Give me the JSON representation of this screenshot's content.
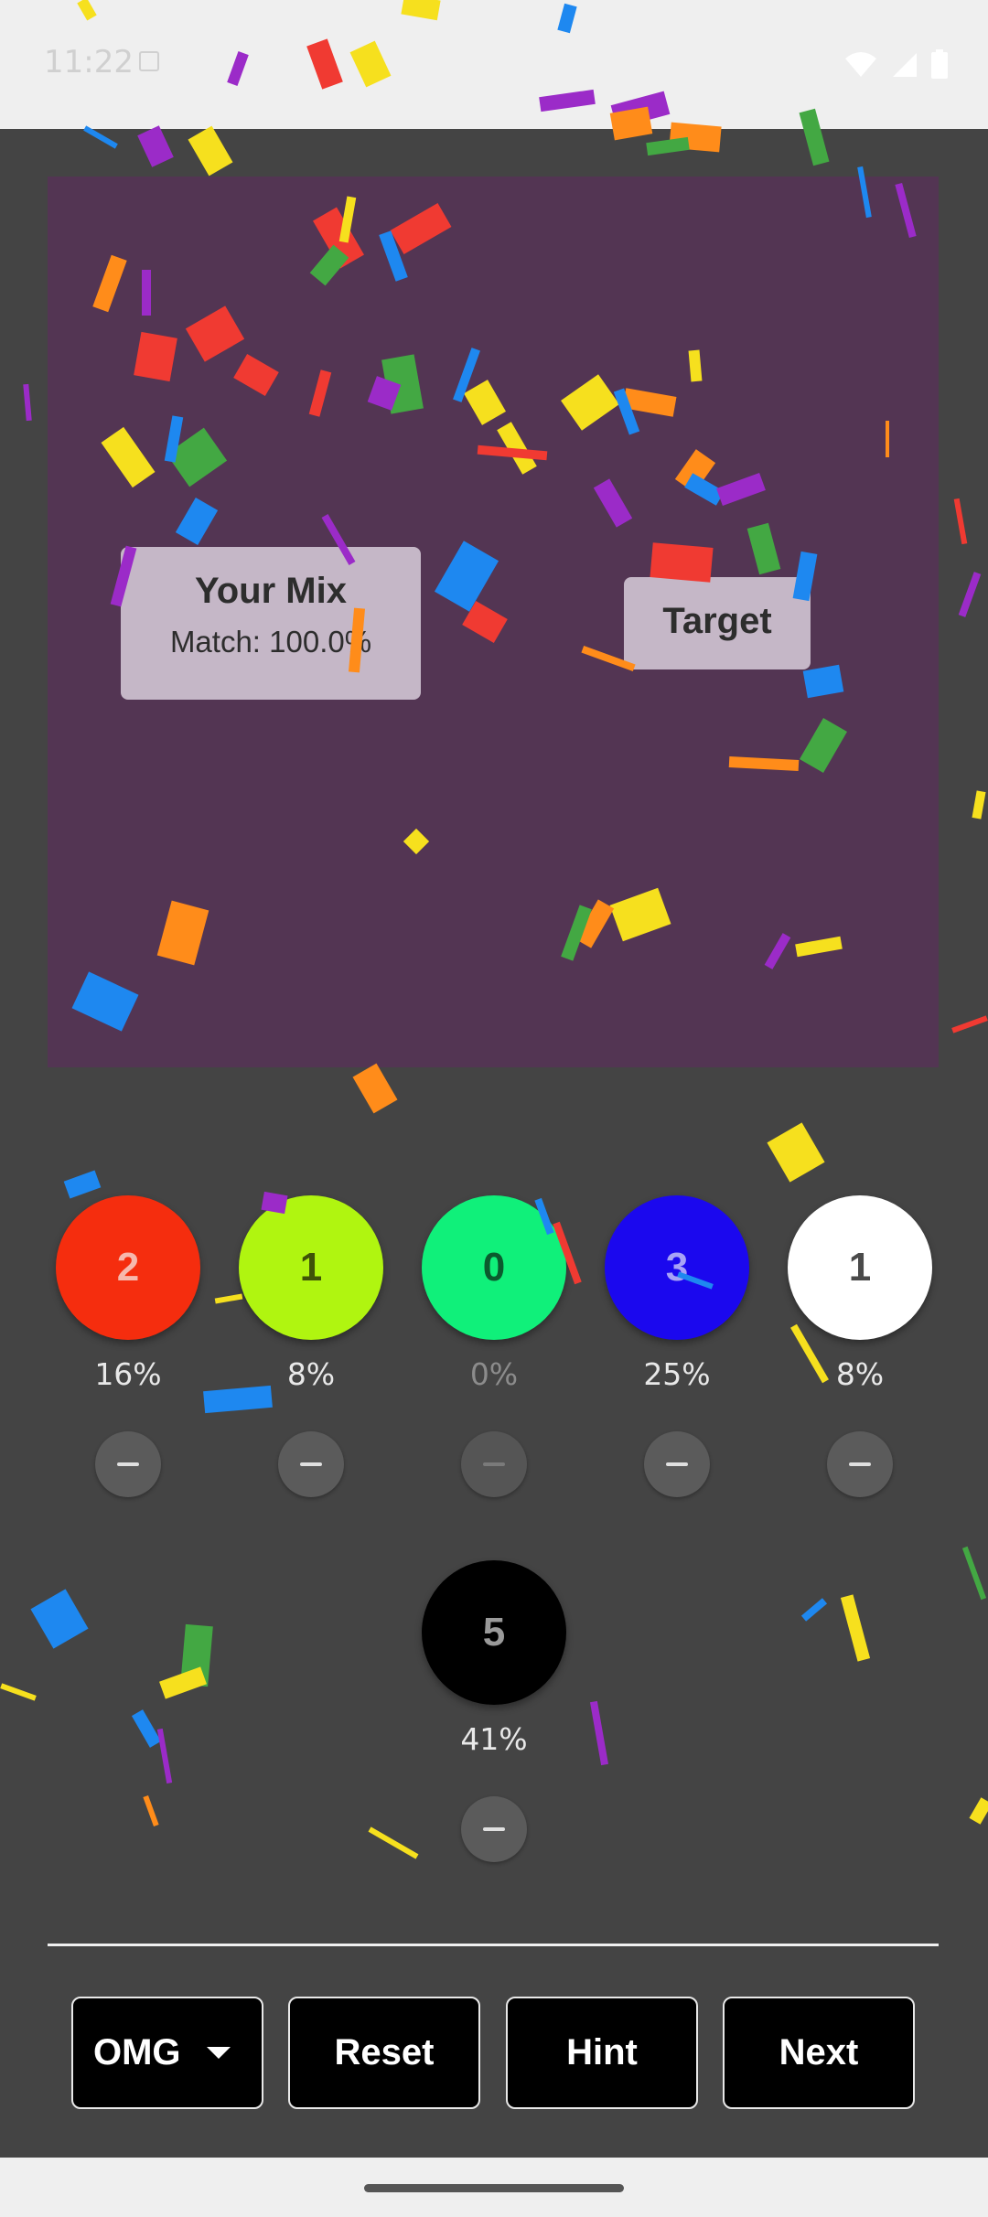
{
  "status_bar": {
    "time": "11:22",
    "icons": [
      "a-icon",
      "wifi-icon",
      "signal-icon",
      "battery-icon"
    ]
  },
  "board": {
    "background": "#533553",
    "your_mix": {
      "title": "Your Mix",
      "match": "Match: 100.0%"
    },
    "target": {
      "title": "Target"
    }
  },
  "colors": [
    {
      "name": "red",
      "hex": "#f52d0e",
      "count": "2",
      "percent": "16%",
      "text_color": "#f6b8ad"
    },
    {
      "name": "lime",
      "hex": "#b0f510",
      "count": "1",
      "percent": "8%",
      "text_color": "#3e5208"
    },
    {
      "name": "green",
      "hex": "#10f07a",
      "count": "0",
      "percent": "0%",
      "text_color": "#0b5a2e"
    },
    {
      "name": "blue",
      "hex": "#1b08ee",
      "count": "3",
      "percent": "25%",
      "text_color": "#a7a2f6"
    },
    {
      "name": "white",
      "hex": "#ffffff",
      "count": "1",
      "percent": "8%",
      "text_color": "#4a4a4a"
    },
    {
      "name": "black",
      "hex": "#000000",
      "count": "5",
      "percent": "41%",
      "text_color": "#9a9a9a"
    }
  ],
  "controls": {
    "difficulty": "OMG",
    "reset": "Reset",
    "hint": "Hint",
    "next": "Next"
  }
}
